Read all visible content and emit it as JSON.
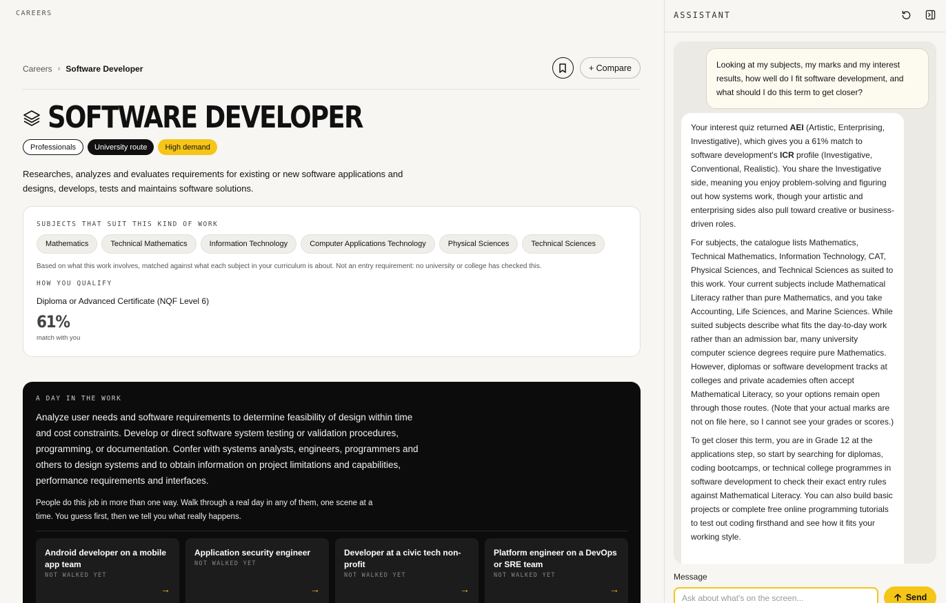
{
  "app": {
    "section_label": "CAREERS"
  },
  "breadcrumb": {
    "root": "Careers",
    "separator": "›",
    "current": "Software Developer"
  },
  "actions": {
    "bookmark_icon": "bookmark-icon",
    "compare_label": "+ Compare"
  },
  "career": {
    "title": "SOFTWARE DEVELOPER",
    "icon": "layers-icon",
    "tags": [
      {
        "label": "Professionals"
      },
      {
        "label": "University route"
      },
      {
        "label": "High demand"
      }
    ],
    "description": "Researches, analyzes and evaluates requirements for existing or new software applications and designs, develops, tests and maintains software solutions."
  },
  "subjects_card": {
    "label": "SUBJECTS THAT SUIT THIS KIND OF WORK",
    "subjects": [
      "Mathematics",
      "Technical Mathematics",
      "Information Technology",
      "Computer Applications Technology",
      "Physical Sciences",
      "Technical Sciences"
    ],
    "note": "Based on what this work involves, matched against what each subject in your curriculum is about. Not an entry requirement: no university or college has checked this.",
    "qualify_label": "HOW YOU QUALIFY",
    "qualification": "Diploma or Advanced Certificate (NQF Level 6)",
    "match_percent": "61%",
    "match_caption": "match with you"
  },
  "day_panel": {
    "label": "A DAY IN THE WORK",
    "summary": "Analyze user needs and software requirements to determine feasibility of design within time and cost constraints. Develop or direct software system testing or validation procedures, programming, or documentation. Confer with systems analysts, engineers, programmers and others to design systems and to obtain information on project limitations and capabilities, performance requirements and interfaces.",
    "intro": "People do this job in more than one way. Walk through a real day in any of them, one scene at a time. You guess first, then we tell you what really happens.",
    "scenarios": [
      {
        "title": "Android developer on a mobile app team",
        "status": "NOT WALKED YET",
        "arrow": "→"
      },
      {
        "title": "Application security engineer",
        "status": "NOT WALKED YET",
        "arrow": "→"
      },
      {
        "title": "Developer at a civic tech non-profit",
        "status": "NOT WALKED YET",
        "arrow": "→"
      },
      {
        "title": "Platform engineer on a DevOps or SRE team",
        "status": "NOT WALKED YET",
        "arrow": "→"
      }
    ]
  },
  "assistant": {
    "title": "ASSISTANT",
    "icons": [
      "refresh-icon",
      "collapse-panel-icon"
    ],
    "user_message": "Looking at my subjects, my marks and my interest results, how well do I fit software development, and what should I do this term to get closer?",
    "reply": {
      "p1_a": "Your interest quiz returned ",
      "p1_b": "AEI",
      "p1_c": " (Artistic, Enterprising, Investigative), which gives you a 61% match to software development's ",
      "p1_d": "ICR",
      "p1_e": " profile (Investigative, Conventional, Realistic). You share the Investigative side, meaning you enjoy problem-solving and figuring out how systems work, though your artistic and enterprising sides also pull toward creative or business-driven roles.",
      "p2": "For subjects, the catalogue lists Mathematics, Technical Mathematics, Information Technology, CAT, Physical Sciences, and Technical Sciences as suited to this work. Your current subjects include Mathematical Literacy rather than pure Mathematics, and you take Accounting, Life Sciences, and Marine Sciences. While suited subjects describe what fits the day-to-day work rather than an admission bar, many university computer science degrees require pure Mathematics. However, diplomas or software development tracks at colleges and private academies often accept Mathematical Literacy, so your options remain open through those routes. (Note that your actual marks are not on file here, so I cannot see your grades or scores.)",
      "p3": "To get closer this term, you are in Grade 12 at the applications step, so start by searching for diplomas, coding bootcamps, or technical college programmes in software development to check their exact entry rules against Mathematical Literacy. You can also build basic projects or complete free online programming tutorials to test out coding firsthand and see how it fits your working style."
    },
    "message_label": "Message",
    "input_placeholder": "Ask about what's on the screen...",
    "send_label": "Send"
  }
}
